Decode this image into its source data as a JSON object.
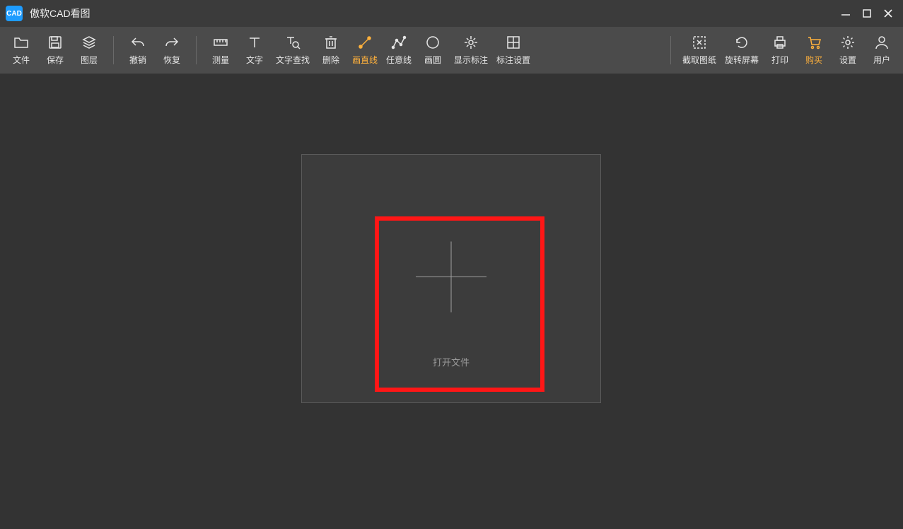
{
  "app": {
    "title": "傲软CAD看图",
    "icon_label": "CAD"
  },
  "toolbar": {
    "groups": [
      {
        "items": [
          {
            "name": "file",
            "label": "文件",
            "icon": "folder"
          },
          {
            "name": "save",
            "label": "保存",
            "icon": "save"
          },
          {
            "name": "layer",
            "label": "图层",
            "icon": "layers"
          }
        ]
      },
      {
        "items": [
          {
            "name": "undo",
            "label": "撤销",
            "icon": "undo"
          },
          {
            "name": "redo",
            "label": "恢复",
            "icon": "redo"
          }
        ]
      },
      {
        "items": [
          {
            "name": "measure",
            "label": "测量",
            "icon": "ruler"
          },
          {
            "name": "text",
            "label": "文字",
            "icon": "text"
          },
          {
            "name": "findtext",
            "label": "文字查找",
            "icon": "findtext",
            "wide": true
          },
          {
            "name": "delete",
            "label": "删除",
            "icon": "delete"
          },
          {
            "name": "line",
            "label": "画直线",
            "icon": "line",
            "highlight": true
          },
          {
            "name": "polyline",
            "label": "任意线",
            "icon": "polyline"
          },
          {
            "name": "circle",
            "label": "画圆",
            "icon": "circle"
          },
          {
            "name": "showmark",
            "label": "显示标注",
            "icon": "showmark",
            "wide": true
          },
          {
            "name": "marksettings",
            "label": "标注设置",
            "icon": "marksettings",
            "wide": true
          }
        ]
      }
    ],
    "right_group": {
      "items": [
        {
          "name": "capture",
          "label": "截取图纸",
          "icon": "capture",
          "wide": true
        },
        {
          "name": "rotate",
          "label": "旋转屏幕",
          "icon": "rotate",
          "wide": true
        },
        {
          "name": "print",
          "label": "打印",
          "icon": "print"
        },
        {
          "name": "buy",
          "label": "购买",
          "icon": "cart",
          "highlight": true
        },
        {
          "name": "settings",
          "label": "设置",
          "icon": "gear"
        },
        {
          "name": "user",
          "label": "用户",
          "icon": "user"
        }
      ]
    }
  },
  "open_area": {
    "open_label": "打开文件"
  }
}
